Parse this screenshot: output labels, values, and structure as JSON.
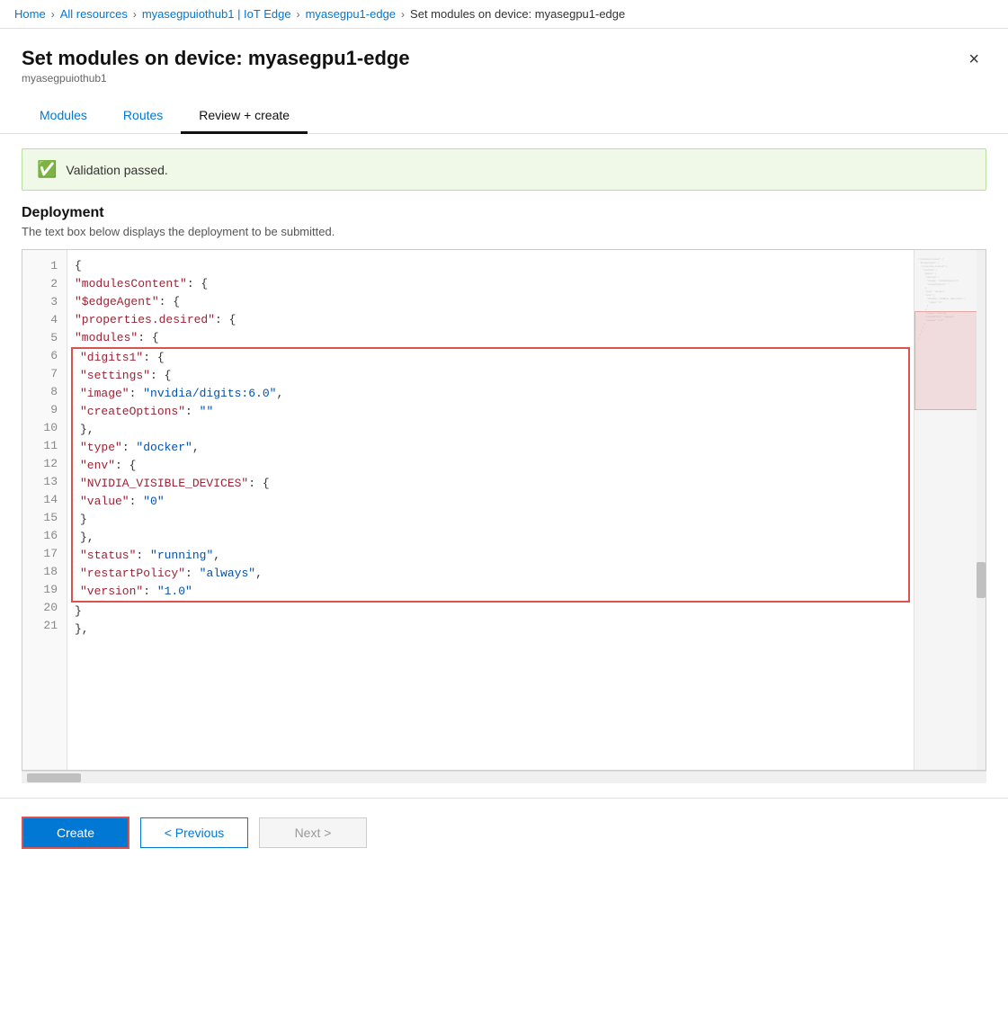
{
  "breadcrumb": {
    "items": [
      {
        "label": "Home",
        "link": true
      },
      {
        "label": "All resources",
        "link": true
      },
      {
        "label": "myasegpuiothub1 | IoT Edge",
        "link": true
      },
      {
        "label": "myasegpu1-edge",
        "link": true
      },
      {
        "label": "Set modules on device: myasegpu1-edge",
        "link": false
      }
    ]
  },
  "panel": {
    "title": "Set modules on device: myasegpu1-edge",
    "subtitle": "myasegpuiothub1",
    "close_label": "×"
  },
  "tabs": [
    {
      "label": "Modules",
      "active": false
    },
    {
      "label": "Routes",
      "active": false
    },
    {
      "label": "Review + create",
      "active": true
    }
  ],
  "validation": {
    "message": "Validation passed."
  },
  "deployment": {
    "title": "Deployment",
    "description": "The text box below displays the deployment to be submitted."
  },
  "code": {
    "lines": [
      {
        "num": 1,
        "content": "{",
        "highlight": false
      },
      {
        "num": 2,
        "content": "    \"modulesContent\": {",
        "highlight": false
      },
      {
        "num": 3,
        "content": "        \"$edgeAgent\": {",
        "highlight": false
      },
      {
        "num": 4,
        "content": "            \"properties.desired\": {",
        "highlight": false
      },
      {
        "num": 5,
        "content": "                \"modules\": {",
        "highlight": false
      },
      {
        "num": 6,
        "content": "                    \"digits1\": {",
        "highlight": true
      },
      {
        "num": 7,
        "content": "                        \"settings\": {",
        "highlight": true
      },
      {
        "num": 8,
        "content": "                            \"image\": \"nvidia/digits:6.0\",",
        "highlight": true
      },
      {
        "num": 9,
        "content": "                            \"createOptions\": \"\"",
        "highlight": true
      },
      {
        "num": 10,
        "content": "                        },",
        "highlight": true
      },
      {
        "num": 11,
        "content": "                        \"type\": \"docker\",",
        "highlight": true
      },
      {
        "num": 12,
        "content": "                        \"env\": {",
        "highlight": true
      },
      {
        "num": 13,
        "content": "                            \"NVIDIA_VISIBLE_DEVICES\": {",
        "highlight": true
      },
      {
        "num": 14,
        "content": "                                \"value\": \"0\"",
        "highlight": true
      },
      {
        "num": 15,
        "content": "                            }",
        "highlight": true
      },
      {
        "num": 16,
        "content": "                        },",
        "highlight": true
      },
      {
        "num": 17,
        "content": "                        \"status\": \"running\",",
        "highlight": true
      },
      {
        "num": 18,
        "content": "                        \"restartPolicy\": \"always\",",
        "highlight": true
      },
      {
        "num": 19,
        "content": "                        \"version\": \"1.0\"",
        "highlight": true
      },
      {
        "num": 20,
        "content": "                    }",
        "highlight": false
      },
      {
        "num": 21,
        "content": "                },",
        "highlight": false
      }
    ]
  },
  "buttons": {
    "create": "Create",
    "previous": "< Previous",
    "next": "Next >"
  }
}
